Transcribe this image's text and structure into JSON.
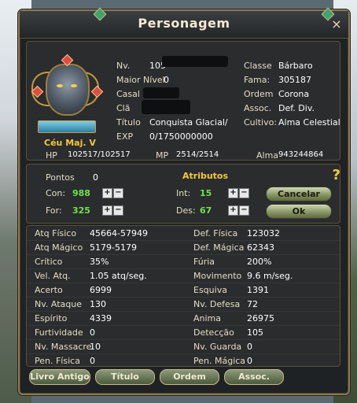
{
  "window": {
    "title": "Personagem",
    "close_icon": "×"
  },
  "character": {
    "name": "Céu Maj. V",
    "hp_label": "HP",
    "hp": "102517/102517",
    "mp_label": "MP",
    "mp": "2514/2514",
    "alma_label": "Alma",
    "alma": "943244864"
  },
  "info_left": [
    {
      "label": "Nv.",
      "value": "105"
    },
    {
      "label": "Maior Nível",
      "value": "0"
    },
    {
      "label": "Casal",
      "value": ""
    },
    {
      "label": "Clã",
      "value": ""
    },
    {
      "label": "Título",
      "value": "Conquista Glacial/"
    },
    {
      "label": "EXP",
      "value": "0/1750000000"
    }
  ],
  "info_right": [
    {
      "label": "Classe",
      "value": "Bárbaro"
    },
    {
      "label": "Fama:",
      "value": "305187"
    },
    {
      "label": "Ordem",
      "value": "Corona"
    },
    {
      "label": "Assoc.",
      "value": "Def. Div."
    },
    {
      "label": "Cultivo:",
      "value": "Alma Celestial"
    }
  ],
  "attributes": {
    "title": "Atributos",
    "points_label": "Pontos",
    "points": "0",
    "con_label": "Con:",
    "con": "988",
    "for_label": "For:",
    "for": "325",
    "int_label": "Int:",
    "int": "15",
    "des_label": "Des:",
    "des": "67",
    "plus": "+",
    "minus": "−",
    "cancel_label": "Cancelar",
    "ok_label": "Ok",
    "help_icon": "?"
  },
  "stats_left": [
    {
      "label": "Atq Físico",
      "value": "45664-57949"
    },
    {
      "label": "Atq Mágico",
      "value": "5179-5179"
    },
    {
      "label": "Crítico",
      "value": "35%"
    },
    {
      "label": "Vel. Atq.",
      "value": "1.05 atq/seg."
    },
    {
      "label": "Acerto",
      "value": "6999"
    },
    {
      "label": "Nv. Ataque",
      "value": "130"
    },
    {
      "label": "Espírito",
      "value": "4339"
    },
    {
      "label": "Furtividade",
      "value": "0"
    },
    {
      "label": "Nv. Massacre",
      "value": "10"
    },
    {
      "label": "Pen. Física",
      "value": "0"
    }
  ],
  "stats_right": [
    {
      "label": "Def. Física",
      "value": "123032"
    },
    {
      "label": "Def. Mágica",
      "value": "62343"
    },
    {
      "label": "Fúria",
      "value": "200%"
    },
    {
      "label": "Movimento",
      "value": "9.6 m/seg."
    },
    {
      "label": "Esquiva",
      "value": "1391"
    },
    {
      "label": "Nv. Defesa",
      "value": "72"
    },
    {
      "label": "Anima",
      "value": "26975"
    },
    {
      "label": "Detecção",
      "value": "105"
    },
    {
      "label": "Nv. Guarda",
      "value": "0"
    },
    {
      "label": "Pen. Mágica",
      "value": "0"
    }
  ],
  "tabs": [
    "Livro Antigo",
    "Título",
    "Ordem",
    "Assoc."
  ]
}
